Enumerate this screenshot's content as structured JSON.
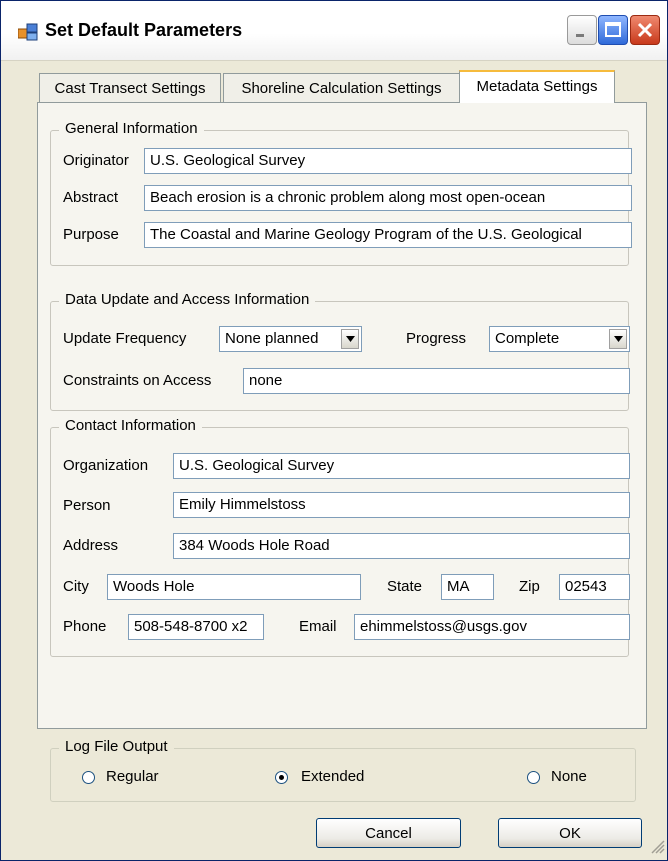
{
  "window": {
    "title": "Set Default Parameters"
  },
  "tabs": [
    {
      "label": "Cast Transect Settings"
    },
    {
      "label": "Shoreline Calculation Settings"
    },
    {
      "label": "Metadata Settings"
    }
  ],
  "general": {
    "legend": "General Information",
    "originator_label": "Originator",
    "originator_value": "U.S. Geological Survey",
    "abstract_label": "Abstract",
    "abstract_value": "Beach erosion is a chronic problem along most open-ocean",
    "purpose_label": "Purpose",
    "purpose_value": "The Coastal and Marine Geology Program of the U.S. Geological"
  },
  "update": {
    "legend": "Data Update and Access Information",
    "frequency_label": "Update Frequency",
    "frequency_value": "None planned",
    "progress_label": "Progress",
    "progress_value": "Complete",
    "constraints_label": "Constraints on Access",
    "constraints_value": "none"
  },
  "contact": {
    "legend": "Contact Information",
    "organization_label": "Organization",
    "organization_value": "U.S. Geological Survey",
    "person_label": "Person",
    "person_value": "Emily Himmelstoss",
    "address_label": "Address",
    "address_value": "384 Woods Hole Road",
    "city_label": "City",
    "city_value": "Woods Hole",
    "state_label": "State",
    "state_value": "MA",
    "zip_label": "Zip",
    "zip_value": "02543",
    "phone_label": "Phone",
    "phone_value": "508-548-8700 x2",
    "email_label": "Email",
    "email_value": "ehimmelstoss@usgs.gov"
  },
  "log": {
    "legend": "Log File Output",
    "options": [
      {
        "label": "Regular",
        "selected": false
      },
      {
        "label": "Extended",
        "selected": true
      },
      {
        "label": "None",
        "selected": false
      }
    ]
  },
  "buttons": {
    "cancel": "Cancel",
    "ok": "OK"
  },
  "icons": {
    "app": "app-window-icon",
    "minimize": "minimize-icon",
    "maximize": "maximize-icon",
    "close": "close-icon",
    "dropdown": "chevron-down-icon",
    "grip": "resize-grip-icon"
  },
  "colors": {
    "active_tab_accent": "#f6bb3c",
    "close_button": "#c8391b",
    "maximize_button": "#2f6ad9"
  }
}
